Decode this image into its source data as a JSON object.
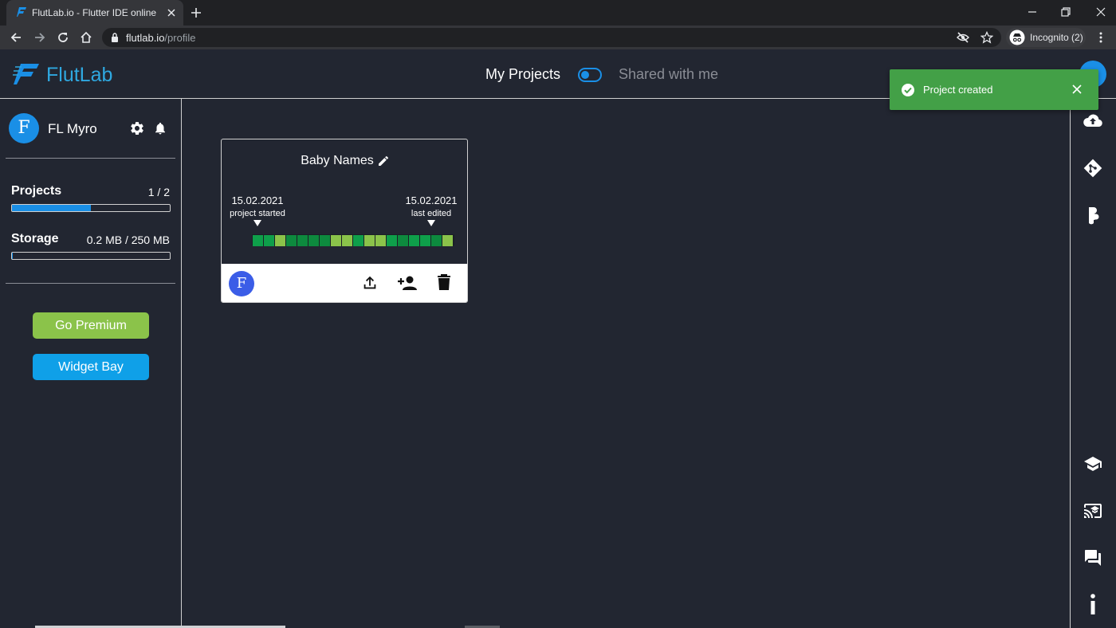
{
  "browser": {
    "tab_title": "FlutLab.io - Flutter IDE online",
    "url_host": "flutlab.io",
    "url_path": "/profile",
    "incognito_label": "Incognito (2)"
  },
  "header": {
    "logo_text": "FlutLab",
    "nav_my_projects": "My Projects",
    "nav_shared": "Shared with me",
    "toggle_state": "my-projects"
  },
  "user": {
    "name": "FL Myro",
    "avatar_letter": "F"
  },
  "stats": {
    "projects_label": "Projects",
    "projects_value": "1 / 2",
    "projects_fraction": 0.5,
    "storage_label": "Storage",
    "storage_value": "0.2 MB / 250 MB",
    "storage_fraction": 0.0008
  },
  "buttons": {
    "premium": "Go Premium",
    "widget_bay": "Widget Bay"
  },
  "project": {
    "name": "Baby Names",
    "started_date": "15.02.2021",
    "started_label": "project started",
    "edited_date": "15.02.2021",
    "edited_label": "last edited",
    "owner_letter": "F",
    "activity": [
      "#0e9f4a",
      "#0e9f4a",
      "#8bc34a",
      "#0d8a3e",
      "#0d8a3e",
      "#0d8a3e",
      "#0d8a3e",
      "#8bc34a",
      "#8bc34a",
      "#0e9f4a",
      "#8bc34a",
      "#8bc34a",
      "#0e9f4a",
      "#0d8a3e",
      "#0e9f4a",
      "#0e9f4a",
      "#0d8a3e",
      "#8bc34a"
    ]
  },
  "toast": {
    "message": "Project created"
  },
  "colors": {
    "accent": "#1a8fe6",
    "premium": "#8bc34a",
    "widget_bay": "#0fa0e8",
    "toast": "#43a047",
    "background": "#222631"
  },
  "icons": {
    "rail_top": [
      "cloud-upload-icon",
      "git-icon",
      "figma-icon"
    ],
    "rail_bottom": [
      "school-icon",
      "cast-for-education-icon",
      "forum-icon",
      "info-icon"
    ]
  }
}
